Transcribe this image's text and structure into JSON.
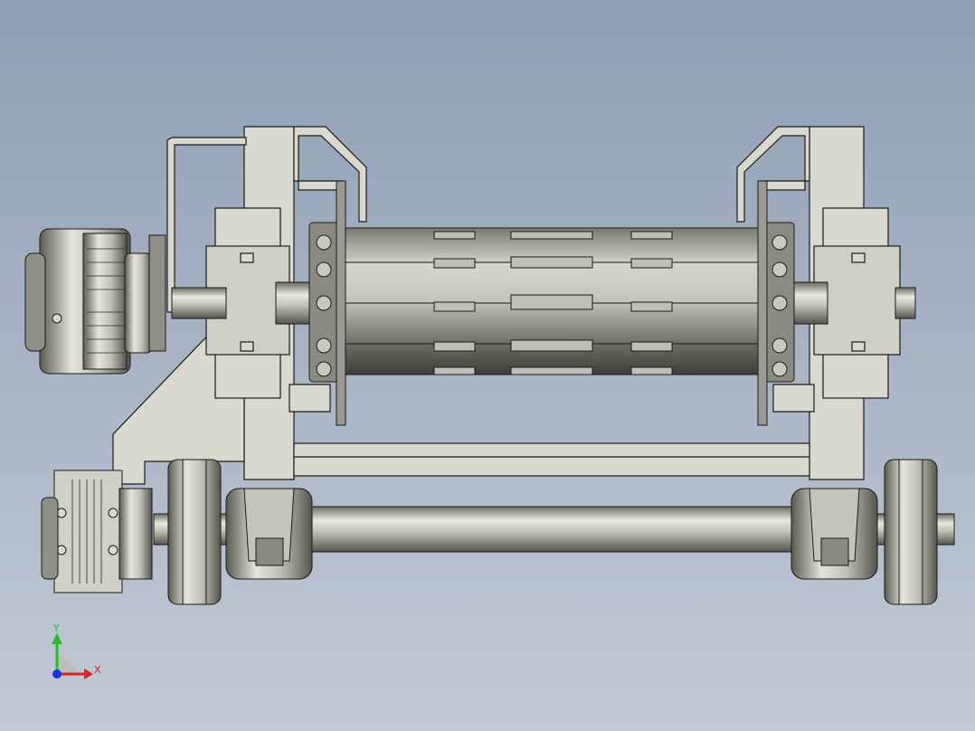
{
  "viewport": {
    "background_top": "#8e9fb5",
    "background_bottom": "#c3cad6",
    "model_fill": "#d9d9cf",
    "model_dark": "#5f5f57",
    "model_mid": "#a9a99f",
    "edge_color": "#1a1a1a"
  },
  "model": {
    "name": "crane-trolley-hoist-assembly",
    "components": [
      "motor-reducer-top",
      "hoist-drum",
      "left-side-frame",
      "right-side-frame",
      "wheel-axle",
      "travel-motor",
      "left-wheel",
      "right-wheel"
    ]
  },
  "triad": {
    "x_label": "X",
    "y_label": "Y",
    "x_color": "#e0201a",
    "y_color": "#22c02a",
    "z_color": "#1a2fe0"
  }
}
